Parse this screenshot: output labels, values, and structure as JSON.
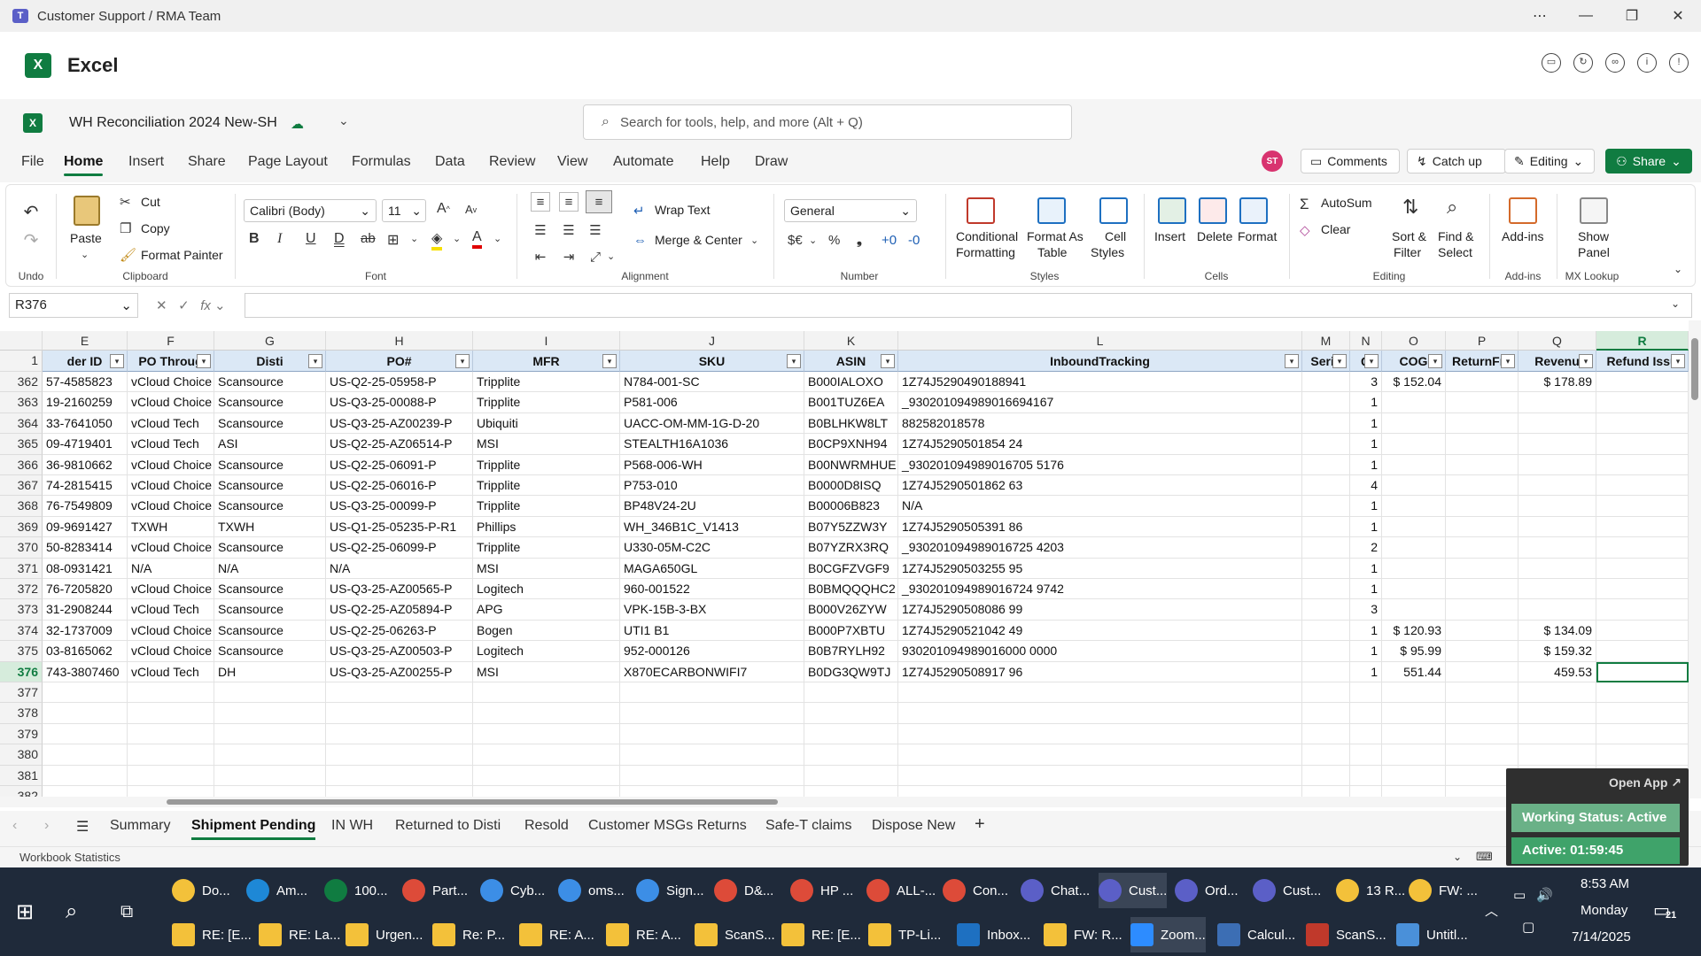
{
  "window": {
    "title": "Customer Support / RMA Team",
    "controls": [
      "⋯",
      "—",
      "❐",
      "✕"
    ]
  },
  "app": {
    "name": "Excel",
    "logo": "X"
  },
  "doc": {
    "name": "WH Reconciliation 2024 New-SH",
    "search_placeholder": "Search for tools, help, and more (Alt + Q)"
  },
  "menu": {
    "tabs": [
      "File",
      "Home",
      "Insert",
      "Share",
      "Page Layout",
      "Formulas",
      "Data",
      "Review",
      "View",
      "Automate",
      "Help",
      "Draw"
    ],
    "active": "Home",
    "avatar": "ST",
    "comments": "Comments",
    "catchup": "Catch up",
    "editing": "Editing",
    "share": "Share"
  },
  "ribbon": {
    "undo_label": "Undo",
    "paste": "Paste",
    "cut": "Cut",
    "copy": "Copy",
    "format_painter": "Format Painter",
    "clipboard_label": "Clipboard",
    "font_name": "Calibri (Body)",
    "font_size": "11",
    "font_label": "Font",
    "wrap_text": "Wrap Text",
    "merge_center": "Merge & Center",
    "alignment_label": "Alignment",
    "number_format": "General",
    "number_label": "Number",
    "conditional_formatting": [
      "Conditional",
      "Formatting"
    ],
    "format_as_table": [
      "Format As",
      "Table"
    ],
    "cell_styles": [
      "Cell",
      "Styles"
    ],
    "styles_label": "Styles",
    "insert": "Insert",
    "delete": "Delete",
    "format": "Format",
    "cells_label": "Cells",
    "autosum": "AutoSum",
    "clear": "Clear",
    "sort_filter": [
      "Sort &",
      "Filter"
    ],
    "find_select": [
      "Find &",
      "Select"
    ],
    "editing_label": "Editing",
    "addins": "Add-ins",
    "addins_label": "Add-ins",
    "show_panel": [
      "Show",
      "Panel"
    ],
    "mx_label": "MX Lookup"
  },
  "formula_bar": {
    "name_box": "R376",
    "fx": "fx",
    "value": ""
  },
  "columns": [
    "E",
    "F",
    "G",
    "H",
    "I",
    "J",
    "K",
    "L",
    "M",
    "N",
    "O",
    "P",
    "Q",
    "R"
  ],
  "selected_column": "R",
  "header_row_number": "1",
  "headers": [
    "der ID",
    "PO Throug",
    "Disti",
    "PO#",
    "MFR",
    "SKU",
    "ASIN",
    "InboundTracking",
    "Seria",
    "Q",
    "COG",
    "ReturnFre",
    "Revenu",
    "Refund Issu"
  ],
  "rows": [
    {
      "num": "362",
      "cells": [
        "57-4585823",
        "vCloud Choice",
        "Scansource",
        "US-Q2-25-05958-P",
        "Tripplite",
        "N784-001-SC",
        "B000IALOXO",
        "1Z74J5290490188941",
        "",
        "3",
        "$ 152.04",
        "",
        "$ 178.89",
        ""
      ]
    },
    {
      "num": "363",
      "cells": [
        "19-2160259",
        "vCloud Choice",
        "Scansource",
        "US-Q3-25-00088-P",
        "Tripplite",
        "P581-006",
        "B001TUZ6EA",
        "_930201094989016694167",
        "",
        "1",
        "",
        "",
        "",
        ""
      ]
    },
    {
      "num": "364",
      "cells": [
        "33-7641050",
        "vCloud Tech",
        "Scansource",
        "US-Q3-25-AZ00239-P",
        "Ubiquiti",
        "UACC-OM-MM-1G-D-20",
        "B0BLHKW8LT",
        "882582018578",
        "",
        "1",
        "",
        "",
        "",
        ""
      ]
    },
    {
      "num": "365",
      "cells": [
        "09-4719401",
        "vCloud Tech",
        "ASI",
        "US-Q2-25-AZ06514-P",
        "MSI",
        "STEALTH16A1036",
        "B0CP9XNH94",
        "1Z74J5290501854 24",
        "",
        "1",
        "",
        "",
        "",
        ""
      ]
    },
    {
      "num": "366",
      "cells": [
        "36-9810662",
        "vCloud Choice",
        "Scansource",
        "US-Q2-25-06091-P",
        "Tripplite",
        "P568-006-WH",
        "B00NWRMHUE",
        "_930201094989016705 5176",
        "",
        "1",
        "",
        "",
        "",
        ""
      ]
    },
    {
      "num": "367",
      "cells": [
        "74-2815415",
        "vCloud Choice",
        "Scansource",
        "US-Q2-25-06016-P",
        "Tripplite",
        "P753-010",
        "B0000D8ISQ",
        "1Z74J5290501862 63",
        "",
        "4",
        "",
        "",
        "",
        ""
      ]
    },
    {
      "num": "368",
      "cells": [
        "76-7549809",
        "vCloud Choice",
        "Scansource",
        "US-Q3-25-00099-P",
        "Tripplite",
        "BP48V24-2U",
        "B00006B823",
        "N/A",
        "",
        "1",
        "",
        "",
        "",
        ""
      ]
    },
    {
      "num": "369",
      "cells": [
        "09-9691427",
        "TXWH",
        "TXWH",
        "US-Q1-25-05235-P-R1",
        "Phillips",
        "WH_346B1C_V1413",
        "B07Y5ZZW3Y",
        "1Z74J5290505391 86",
        "",
        "1",
        "",
        "",
        "",
        ""
      ]
    },
    {
      "num": "370",
      "cells": [
        "50-8283414",
        "vCloud Choice",
        "Scansource",
        "US-Q2-25-06099-P",
        "Tripplite",
        "U330-05M-C2C",
        "B07YZRX3RQ",
        "_930201094989016725 4203",
        "",
        "2",
        "",
        "",
        "",
        ""
      ]
    },
    {
      "num": "371",
      "cells": [
        "08-0931421",
        "N/A",
        "N/A",
        "N/A",
        "MSI",
        "MAGA650GL",
        "B0CGFZVGF9",
        "1Z74J5290503255 95",
        "",
        "1",
        "",
        "",
        "",
        ""
      ]
    },
    {
      "num": "372",
      "cells": [
        "76-7205820",
        "vCloud Choice",
        "Scansource",
        "US-Q3-25-AZ00565-P",
        "Logitech",
        "960-001522",
        "B0BMQQQHC2",
        "_930201094989016724 9742",
        "",
        "1",
        "",
        "",
        "",
        ""
      ]
    },
    {
      "num": "373",
      "cells": [
        "31-2908244",
        "vCloud Tech",
        "Scansource",
        "US-Q2-25-AZ05894-P",
        "APG",
        "VPK-15B-3-BX",
        "B000V26ZYW",
        "1Z74J5290508086 99",
        "",
        "3",
        "",
        "",
        "",
        ""
      ]
    },
    {
      "num": "374",
      "cells": [
        "32-1737009",
        "vCloud Choice",
        "Scansource",
        "US-Q2-25-06263-P",
        "Bogen",
        "UTI1 B1",
        "B000P7XBTU",
        "1Z74J5290521042 49",
        "",
        "1",
        "$ 120.93",
        "",
        "$ 134.09",
        ""
      ]
    },
    {
      "num": "375",
      "cells": [
        "03-8165062",
        "vCloud Choice",
        "Scansource",
        "US-Q3-25-AZ00503-P",
        "Logitech",
        "952-000126",
        "B0B7RYLH92",
        "930201094989016000 0000",
        "",
        "1",
        "$ 95.99",
        "",
        "$ 159.32",
        ""
      ]
    },
    {
      "num": "376",
      "cells": [
        "743-3807460",
        "vCloud Tech",
        "DH",
        "US-Q3-25-AZ00255-P",
        "MSI",
        "X870ECARBONWIFI7",
        "B0DG3QW9TJ",
        "1Z74J5290508917 96",
        "",
        "1",
        "551.44",
        "",
        "459.53",
        ""
      ]
    },
    {
      "num": "377",
      "cells": [
        "",
        "",
        "",
        "",
        "",
        "",
        "",
        "",
        "",
        "",
        "",
        "",
        "",
        ""
      ]
    },
    {
      "num": "378",
      "cells": [
        "",
        "",
        "",
        "",
        "",
        "",
        "",
        "",
        "",
        "",
        "",
        "",
        "",
        ""
      ]
    },
    {
      "num": "379",
      "cells": [
        "",
        "",
        "",
        "",
        "",
        "",
        "",
        "",
        "",
        "",
        "",
        "",
        "",
        ""
      ]
    },
    {
      "num": "380",
      "cells": [
        "",
        "",
        "",
        "",
        "",
        "",
        "",
        "",
        "",
        "",
        "",
        "",
        "",
        ""
      ]
    },
    {
      "num": "381",
      "cells": [
        "",
        "",
        "",
        "",
        "",
        "",
        "",
        "",
        "",
        "",
        "",
        "",
        "",
        ""
      ]
    },
    {
      "num": "382",
      "cells": [
        "",
        "",
        "",
        "",
        "",
        "",
        "",
        "",
        "",
        "",
        "",
        "",
        "",
        ""
      ]
    }
  ],
  "sheets": [
    "Summary",
    "Shipment Pending",
    "IN WH",
    "Returned to Disti",
    "Resold",
    "Customer MSGs Returns",
    "Safe-T claims",
    "Dispose New"
  ],
  "active_sheet": "Shipment Pending",
  "status": {
    "left": "Workbook Statistics"
  },
  "zoom_widget": {
    "open_app": "Open App ↗",
    "working_status": "Working Status: Active",
    "active_time": "Active: 01:59:45"
  },
  "taskbar": {
    "row1": [
      "Do...",
      "Am...",
      "100...",
      "Part...",
      "Cyb...",
      "oms...",
      "Sign...",
      "D&...",
      "HP ...",
      "ALL-...",
      "Con...",
      "Chat...",
      "Cust...",
      "Ord...",
      "Cust...",
      "13 R...",
      "FW: ..."
    ],
    "row2": [
      "RE: [E...",
      "RE: La...",
      "Urgen...",
      "Re: P...",
      "RE: A...",
      "RE: A...",
      "ScanS...",
      "RE: [E...",
      "TP-Li...",
      "Inbox...",
      "FW: R...",
      "Zoom...",
      "Calcul...",
      "ScanS...",
      "Untitl..."
    ],
    "time": "8:53 AM",
    "day": "Monday",
    "date": "7/14/2025",
    "notif": "21"
  }
}
